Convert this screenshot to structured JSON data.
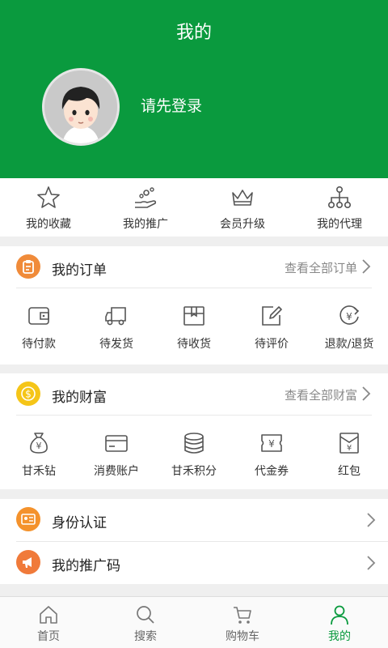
{
  "header": {
    "title": "我的",
    "login_text": "请先登录"
  },
  "quick_links": [
    {
      "label": "我的收藏",
      "icon": "star-icon"
    },
    {
      "label": "我的推广",
      "icon": "hand-share-icon"
    },
    {
      "label": "会员升级",
      "icon": "crown-icon"
    },
    {
      "label": "我的代理",
      "icon": "network-icon"
    }
  ],
  "orders": {
    "title": "我的订单",
    "more": "查看全部订单",
    "items": [
      {
        "label": "待付款",
        "icon": "wallet-icon"
      },
      {
        "label": "待发货",
        "icon": "truck-icon"
      },
      {
        "label": "待收货",
        "icon": "box-icon"
      },
      {
        "label": "待评价",
        "icon": "edit-icon"
      },
      {
        "label": "退款/退货",
        "icon": "refund-icon"
      }
    ]
  },
  "wealth": {
    "title": "我的财富",
    "more": "查看全部财富",
    "items": [
      {
        "label": "甘禾钻",
        "icon": "money-bag-icon"
      },
      {
        "label": "消费账户",
        "icon": "card-icon"
      },
      {
        "label": "甘禾积分",
        "icon": "coins-icon"
      },
      {
        "label": "代金券",
        "icon": "voucher-icon"
      },
      {
        "label": "红包",
        "icon": "red-envelope-icon"
      }
    ]
  },
  "misc": {
    "identity": "身份认证",
    "promo_code": "我的推广码"
  },
  "tabbar": [
    {
      "label": "首页",
      "icon": "home-icon"
    },
    {
      "label": "搜索",
      "icon": "search-icon"
    },
    {
      "label": "购物车",
      "icon": "cart-icon"
    },
    {
      "label": "我的",
      "icon": "user-icon"
    }
  ],
  "colors": {
    "brand_green": "#0a9a3e",
    "order_orange": "#f08b3a",
    "wealth_yellow": "#f5c518",
    "identity_orange": "#f4922c",
    "promo_orange": "#f07a3a"
  }
}
